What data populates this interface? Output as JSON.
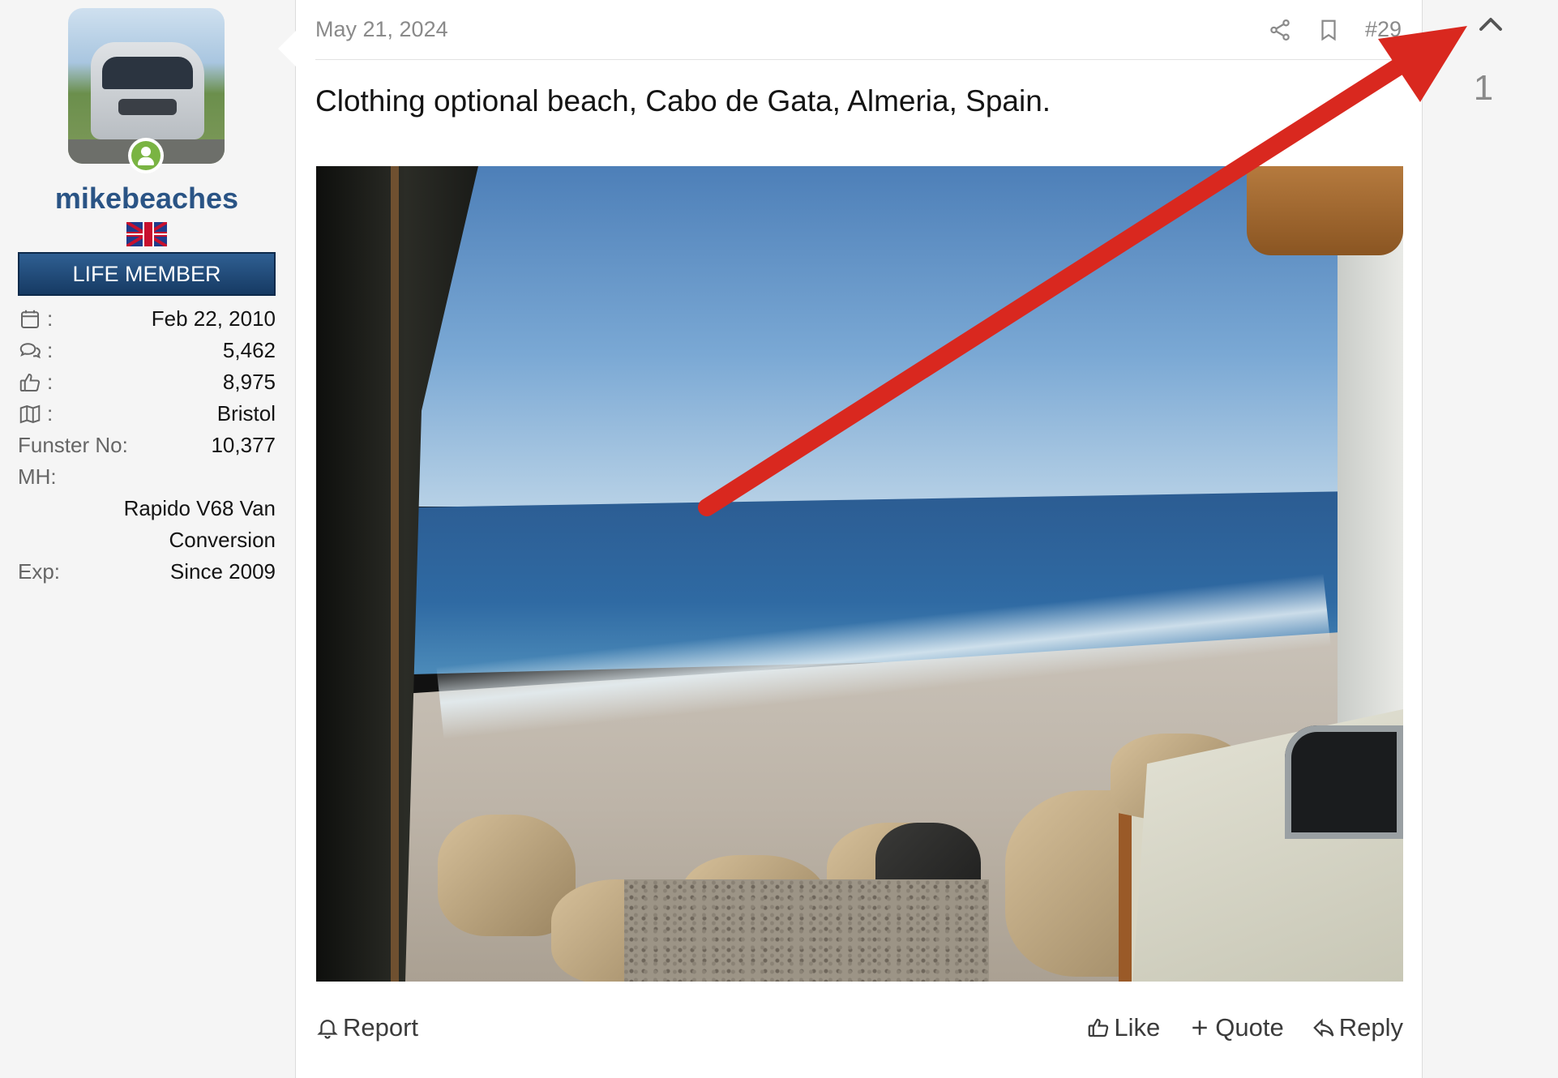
{
  "user": {
    "username": "mikebeaches",
    "flag_icon": "uk-flag-icon",
    "badge": "LIFE MEMBER",
    "stats": [
      {
        "icon": "calendar-icon",
        "key": ":",
        "value": "Feb 22, 2010"
      },
      {
        "icon": "messages-icon",
        "key": ":",
        "value": "5,462"
      },
      {
        "icon": "thumbs-up-icon",
        "key": ":",
        "value": "8,975"
      },
      {
        "icon": "map-icon",
        "key": ":",
        "value": "Bristol"
      }
    ],
    "funster_label": "Funster No:",
    "funster_value": "10,377",
    "mh_label": "MH:",
    "mh_value_line1": "Rapido V68 Van",
    "mh_value_line2": "Conversion",
    "exp_label": "Exp:",
    "exp_value": "Since 2009"
  },
  "post": {
    "date": "May 21, 2024",
    "number": "#29",
    "message": "Clothing optional beach, Cabo de Gata, Almeria, Spain."
  },
  "footer": {
    "report": "Report",
    "like": "Like",
    "quote": "Quote",
    "reply": "Reply"
  },
  "vote": {
    "count": "1"
  },
  "colors": {
    "username": "#2a5485",
    "badge_bg": "#1f4a78",
    "annotation_arrow": "#d9281f",
    "online": "#7ab443"
  }
}
